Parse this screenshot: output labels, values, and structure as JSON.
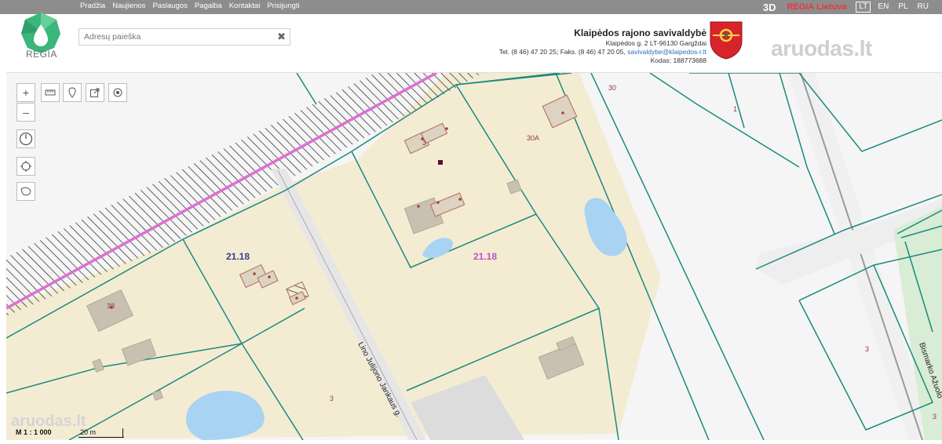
{
  "nav": [
    "Pradžia",
    "Naujienos",
    "Paslaugos",
    "Pagalba",
    "Kontaktai",
    "Prisijungti"
  ],
  "top_right": {
    "mode": "3D",
    "brand": "REGIA Lietuva",
    "langs": [
      "LT",
      "EN",
      "PL",
      "RU"
    ]
  },
  "logo": {
    "text": "REGIA"
  },
  "search": {
    "placeholder": "Adresų paieška",
    "clear": "✖"
  },
  "municipality": {
    "name": "Klaipėdos rajono savivaldybė",
    "address": "Klaipėdos g. 2 LT-96130 Gargždai",
    "phone": "Tel. (8 46) 47 20 25; Faks. (8 46) 47 20 05,",
    "email": "savivaldybe@klaipedos-r.lt",
    "code": "Kodas: 188773688"
  },
  "watermark": "aruodas.lt",
  "map": {
    "labels": {
      "plot_left": "21.18",
      "plot_right": "21.18",
      "n30": "30",
      "n30a": "30A",
      "n1": "1",
      "n3a": "3",
      "n3b": "3",
      "n3c": "3",
      "n3d": "3",
      "n38": "38"
    },
    "streets": {
      "main": "Lino Julijono Jankaus g.",
      "right": "Bismarko Ažuolo"
    }
  },
  "scale": {
    "ratio": "M 1 : 1 000",
    "bar": "20 m"
  },
  "colors": {
    "parcel": "#f3ecd3",
    "boundary": "#1a8a7d",
    "building": "#c9c0b1",
    "water": "#a9d3f2",
    "rail": "#dd6fd3"
  }
}
